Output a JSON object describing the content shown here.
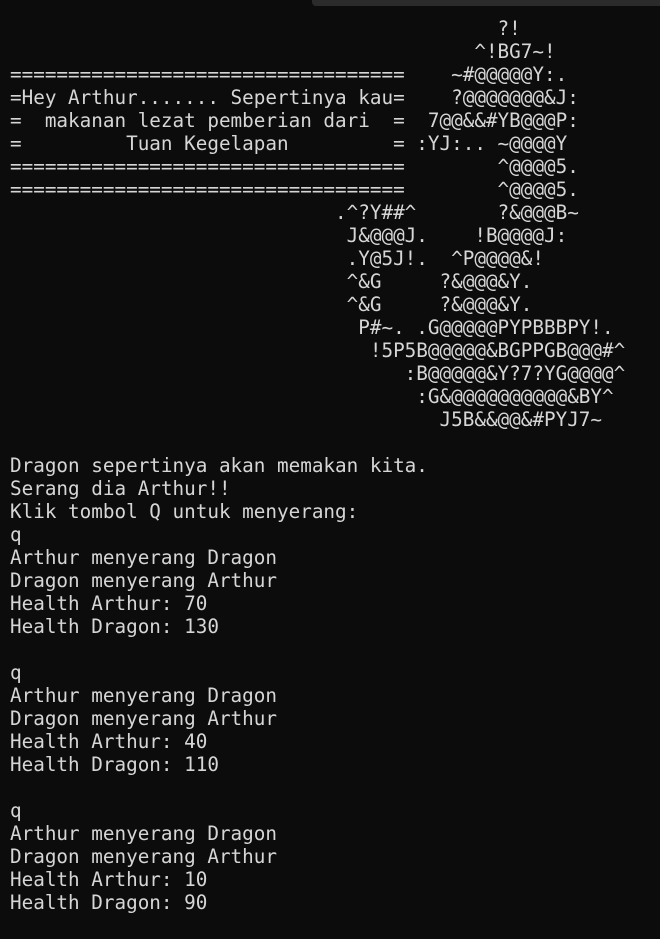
{
  "terminal": {
    "lines": [
      "                                          ?!",
      "                                        ^!BG7~!",
      "==================================    ~#@@@@@Y:.",
      "=Hey Arthur....... Sepertinya kau=    ?@@@@@@@&J:",
      "=  makanan lezat pemberian dari  =  7@@&&#YB@@@P:",
      "=         Tuan Kegelapan         = :YJ:.. ~@@@@Y",
      "==================================        ^@@@@5.",
      "==================================        ^@@@@5.",
      "                            .^?Y##^       ?&@@@B~",
      "                             J&@@@J.    !B@@@@J:",
      "                             .Y@5J!.  ^P@@@@&!",
      "                             ^&G     ?&@@@&Y.",
      "                             ^&G     ?&@@@&Y.",
      "                              P#~. .G@@@@@PYPBBBPY!.",
      "                               !5P5B@@@@@&BGPPGB@@@#^",
      "                                  :B@@@@@&Y?7?YG@@@@^",
      "                                   :G&@@@@@@@@@@&BY^",
      "                                     J5B&&@@&#PYJ7~",
      "",
      "Dragon sepertinya akan memakan kita.",
      "Serang dia Arthur!!",
      "Klik tombol Q untuk menyerang:",
      "q",
      "Arthur menyerang Dragon",
      "Dragon menyerang Arthur",
      "Health Arthur: 70",
      "Health Dragon: 130",
      "",
      "q",
      "Arthur menyerang Dragon",
      "Dragon menyerang Arthur",
      "Health Arthur: 40",
      "Health Dragon: 110",
      "",
      "q",
      "Arthur menyerang Dragon",
      "Dragon menyerang Arthur",
      "Health Arthur: 10",
      "Health Dragon: 90"
    ]
  },
  "colors": {
    "background": "#0c0c0c",
    "text": "#d6d6d6",
    "tab_strip": "#2b2b2b"
  }
}
